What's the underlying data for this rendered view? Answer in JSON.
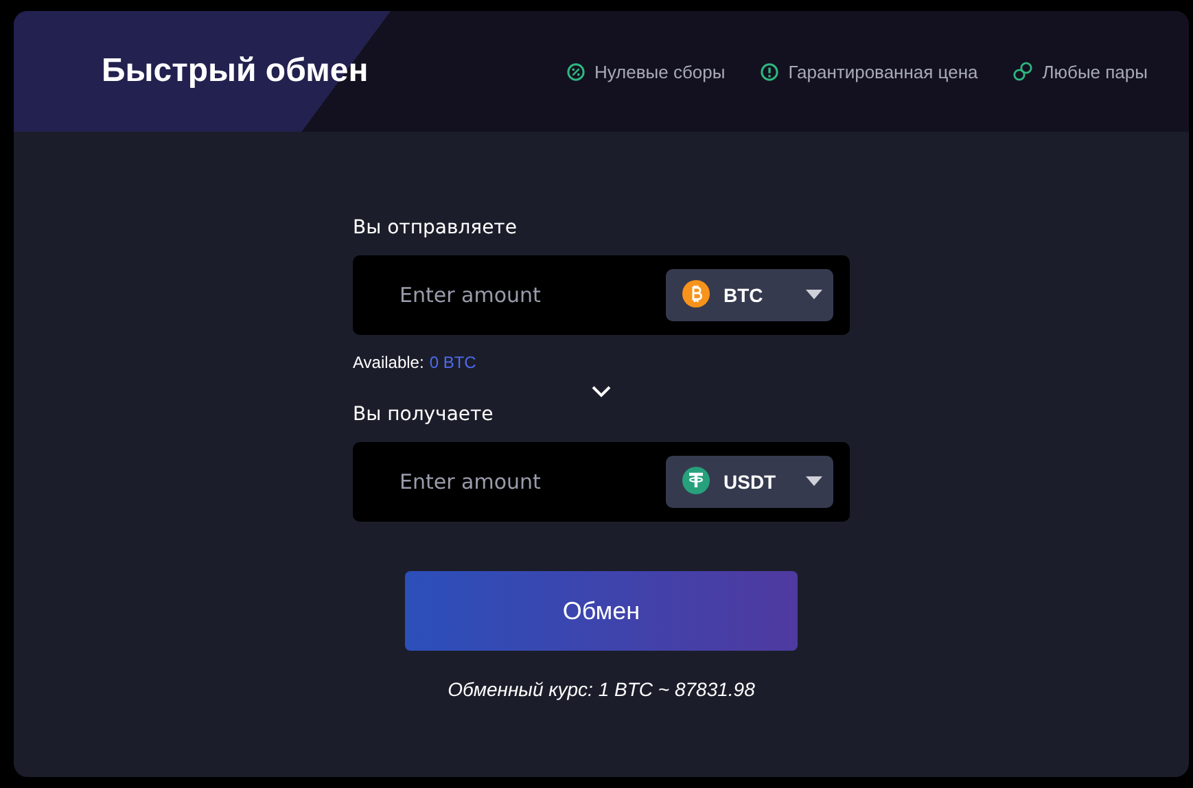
{
  "header": {
    "title": "Быстрый обмен",
    "features": [
      {
        "kind": "percent",
        "label": "Нулевые сборы"
      },
      {
        "kind": "alert",
        "label": "Гарантированная цена"
      },
      {
        "kind": "coins",
        "label": "Любые пары"
      }
    ]
  },
  "send": {
    "label": "Вы отправляете",
    "placeholder": "Enter amount",
    "currency": {
      "kind": "btc",
      "code": "BTC"
    }
  },
  "available": {
    "label": "Available:",
    "value": "0 BTC"
  },
  "receive": {
    "label": "Вы получаете",
    "placeholder": "Enter amount",
    "currency": {
      "kind": "usdt",
      "code": "USDT"
    }
  },
  "submit": "Обмен",
  "rate": "Обменный курс: 1 BTC ~ 87831.98"
}
